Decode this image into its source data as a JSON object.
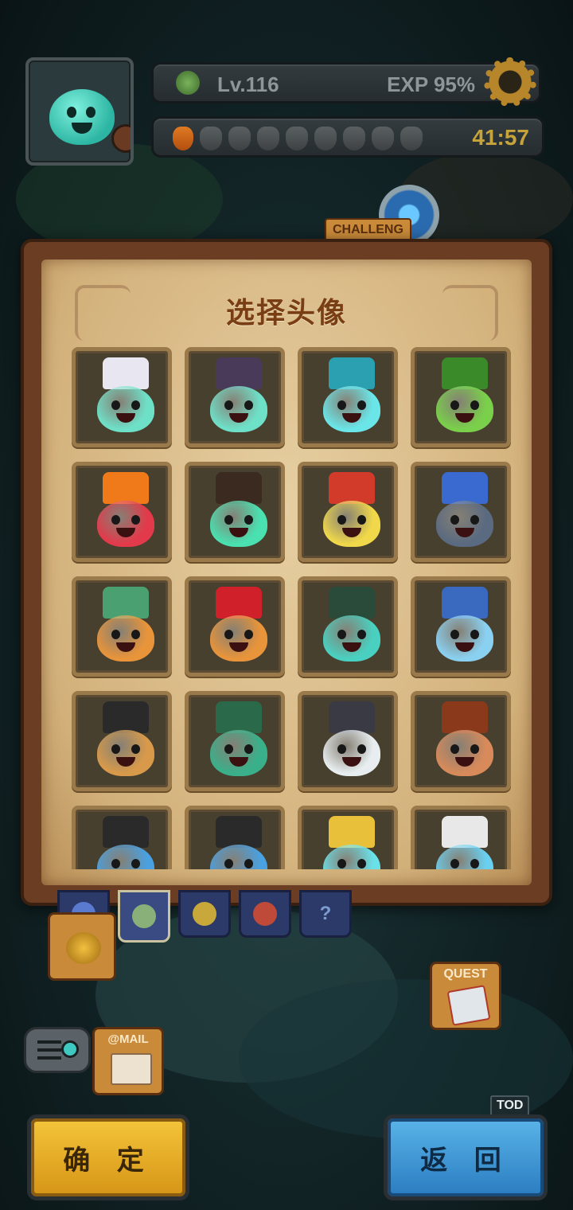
{
  "hud": {
    "level": "Lv.116",
    "exp": "EXP  95%",
    "energy_timer": "41:57",
    "energy_full": 1,
    "energy_max": 9
  },
  "map": {
    "challenge_tag": "CHALLENG",
    "quest_label": "QUEST",
    "mail_label": "@MAIL",
    "tod_tag": "TOD"
  },
  "panel": {
    "title": "选择头像"
  },
  "avatars": [
    {
      "name": "bishop",
      "body": "#6fe0c8",
      "hat": "#e8e6f0"
    },
    {
      "name": "witch",
      "body": "#6fe0c8",
      "hat": "#4a3a5a"
    },
    {
      "name": "cyan-captain",
      "body": "#6ae6e8",
      "hat": "#2aa0b0"
    },
    {
      "name": "green-dragon",
      "body": "#7ad04a",
      "hat": "#3a8a2a"
    },
    {
      "name": "red-demon",
      "body": "#e23a4a",
      "hat": "#f07a1a"
    },
    {
      "name": "gentleman",
      "body": "#4ae0b0",
      "hat": "#3a2a20"
    },
    {
      "name": "yellow-king",
      "body": "#f0d84a",
      "hat": "#d23a2a"
    },
    {
      "name": "ice-knight",
      "body": "#5a6a80",
      "hat": "#3a6ad0"
    },
    {
      "name": "forest-pumpkin",
      "body": "#e8943a",
      "hat": "#4aa070"
    },
    {
      "name": "xmas-pumpkin",
      "body": "#e8943a",
      "hat": "#d0202a"
    },
    {
      "name": "horned-green",
      "body": "#4ad0c0",
      "hat": "#2a4a3a"
    },
    {
      "name": "frost-king",
      "body": "#8ad0f0",
      "hat": "#3a6ac0"
    },
    {
      "name": "cyborg",
      "body": "#d89a4a",
      "hat": "#2a2a2a"
    },
    {
      "name": "gunner",
      "body": "#3ab08a",
      "hat": "#2a6a4a"
    },
    {
      "name": "silver-warlord",
      "body": "#e8eef0",
      "hat": "#3a3a44"
    },
    {
      "name": "bull-warrior",
      "body": "#d88a5a",
      "hat": "#8a3a1a"
    },
    {
      "name": "masked-blue",
      "body": "#4aa0e0",
      "hat": "#2a2a2a"
    },
    {
      "name": "rainbow-strong",
      "body": "#4aa0e0",
      "hat": "#2a2a2a"
    },
    {
      "name": "crowned-blue",
      "body": "#6ae0e8",
      "hat": "#e8c03a"
    },
    {
      "name": "turban-blue",
      "body": "#6ad0f0",
      "hat": "#e8e8e8"
    }
  ],
  "tabs": [
    {
      "name": "tab-gorilla",
      "color": "#5a7ad0"
    },
    {
      "name": "tab-knight",
      "color": "#8ab07a"
    },
    {
      "name": "tab-cat",
      "color": "#c8a83a"
    },
    {
      "name": "tab-demon",
      "color": "#c04a3a"
    },
    {
      "name": "tab-unknown",
      "label": "?"
    }
  ],
  "buttons": {
    "confirm": "确 定",
    "back": "返 回"
  }
}
